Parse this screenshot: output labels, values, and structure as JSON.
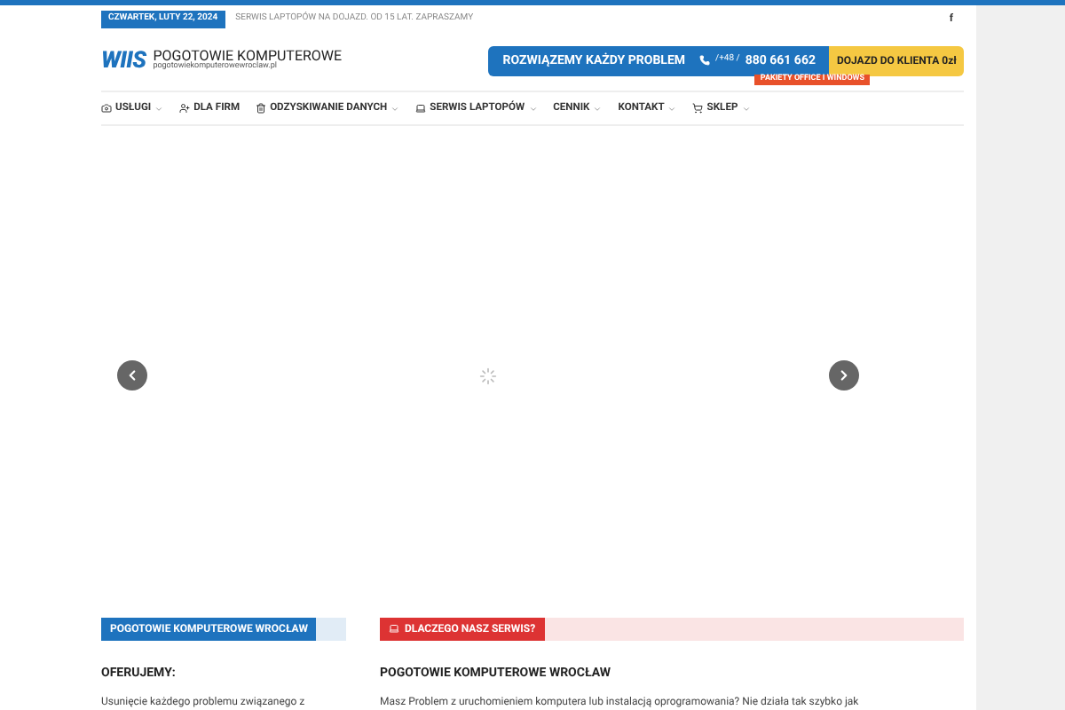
{
  "topbar": {
    "date": "CZWARTEK, LUTY 22, 2024",
    "ticker": "SERWIS LAPTOPÓW NA DOJAZD. OD 15 LAT. ZAPRASZAMY",
    "social": "f"
  },
  "logo": {
    "mark": "WIIS",
    "title": "POGOTOWIE KOMPUTEROWE",
    "domain": "pogotowiekomputerowewroclaw.pl"
  },
  "banner": {
    "slogan": "ROZWIĄZEMY KAŻDY PROBLEM",
    "phone_prefix": "/+48 /",
    "phone": "880 661 662",
    "cta": "DOJAZD DO KLIENTA 0zł",
    "ribbon": "PAKIETY OFFICE I WINDOWS"
  },
  "nav": [
    {
      "label": "USŁUGI",
      "dropdown": true
    },
    {
      "label": "DLA FIRM",
      "dropdown": false
    },
    {
      "label": "ODZYSKIWANIE DANYCH",
      "dropdown": true
    },
    {
      "label": "SERWIS LAPTOPÓW",
      "dropdown": true
    },
    {
      "label": "CENNIK",
      "dropdown": true
    },
    {
      "label": "KONTAKT",
      "dropdown": true
    },
    {
      "label": "SKLEP",
      "dropdown": true
    }
  ],
  "sections": [
    {
      "title": "POGOTOWIE KOMPUTEROWE WROCŁAW",
      "color": "#1e73be",
      "icon": false,
      "heading": "OFERUJEMY:",
      "text": "Usunięcie każdego problemu związanego z"
    },
    {
      "title": "DLACZEGO NASZ SERWIS?",
      "color": "#dd3333",
      "icon": true,
      "heading": "POGOTOWIE KOMPUTEROWE WROCŁAW",
      "text": "Masz Problem z uruchomieniem komputera lub instalacją oprogramowania? Nie działa tak szybko jak"
    }
  ]
}
